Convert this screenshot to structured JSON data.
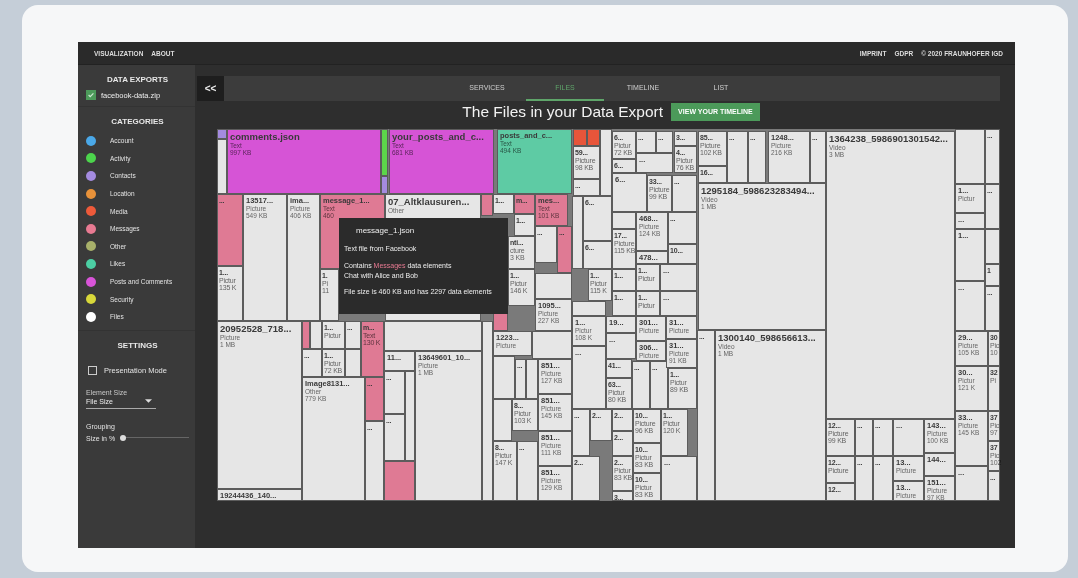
{
  "top_bar": {
    "left_links": [
      "VISUALIZATION",
      "ABOUT"
    ],
    "right_links": [
      "IMPRINT",
      "GDPR",
      "© 2020 FRAUNHOFER IGD"
    ]
  },
  "sidebar": {
    "exports_title": "DATA EXPORTS",
    "exports": [
      {
        "label": "facebook-data.zip",
        "checked": true
      }
    ],
    "categories_title": "CATEGORIES",
    "categories": [
      {
        "label": "Account",
        "color": "#4aa8e8"
      },
      {
        "label": "Activity",
        "color": "#4cd44c"
      },
      {
        "label": "Contacts",
        "color": "#a48be0"
      },
      {
        "label": "Location",
        "color": "#e8923a"
      },
      {
        "label": "Media",
        "color": "#ee5a3a"
      },
      {
        "label": "Messages",
        "color": "#e87a92"
      },
      {
        "label": "Other",
        "color": "#a8b06a"
      },
      {
        "label": "Likes",
        "color": "#4ccfa4"
      },
      {
        "label": "Posts and Comments",
        "color": "#d854d8"
      },
      {
        "label": "Security",
        "color": "#d8d83a"
      },
      {
        "label": "Files",
        "color": "#ffffff"
      }
    ],
    "settings_title": "SETTINGS",
    "presentation_mode": {
      "label": "Presentation Mode",
      "checked": false
    },
    "element_size": {
      "label": "Element Size",
      "value": "File Size"
    },
    "grouping": {
      "label": "Grouping Size in %",
      "level": 0
    }
  },
  "collapse_button": "<<",
  "tabs": [
    {
      "label": "SERVICES",
      "selected": false
    },
    {
      "label": "FILES",
      "selected": true
    },
    {
      "label": "TIMELINE",
      "selected": false
    },
    {
      "label": "LIST",
      "selected": false
    }
  ],
  "heading": "The Files in your Data Export",
  "timeline_button": "VIEW YOUR TIMELINE",
  "tiles": [
    {
      "color": "#a48be0"
    },
    {
      "label": "comments.json",
      "type": "Text",
      "size": "997 KB",
      "color": "#d654d6"
    },
    {
      "color": "#5cd64a"
    },
    {
      "label": "your_posts_and_c...",
      "type": "Text",
      "size": "681 KB",
      "color": "#d654d6"
    },
    {
      "label": "posts_and_c...",
      "type": "Text",
      "size": "494 KB",
      "color": "#5ecba4"
    },
    {
      "color": "#e8553a"
    },
    {
      "color": "#e8553a"
    },
    {
      "color": "#e6e6e6"
    },
    {
      "label": "6...",
      "type": "Pictur",
      "size": "72 KB",
      "color": "#e6e6e6"
    },
    {
      "label": "...",
      "color": "#e6e6e6"
    },
    {
      "label": "...",
      "color": "#e6e6e6"
    },
    {
      "label": "3...",
      "color": "#e6e6e6"
    },
    {
      "label": "85...",
      "type": "Picture",
      "size": "102 KB",
      "color": "#e6e6e6"
    },
    {
      "label": "...",
      "color": "#e6e6e6"
    },
    {
      "label": "...",
      "color": "#e6e6e6"
    },
    {
      "label": "1248...",
      "type": "Picture",
      "size": "216 KB",
      "color": "#e6e6e6"
    },
    {
      "label": "...",
      "color": "#e6e6e6"
    },
    {
      "label": "1364238_5986901301542...",
      "type": "Video",
      "size": "3 MB",
      "color": "#e6e6e6"
    },
    {
      "color": "#e6e6e6"
    },
    {
      "label": "...",
      "color": "#e6e6e6"
    },
    {
      "color": "#e6e6e6"
    },
    {
      "label": "59...",
      "type": "Picture",
      "size": "98 KB",
      "color": "#e6e6e6"
    },
    {
      "label": "6...",
      "color": "#e6e6e6"
    },
    {
      "label": "...",
      "color": "#e6e6e6"
    },
    {
      "label": "4...",
      "type": "Pictur",
      "size": "76 KB",
      "color": "#e6e6e6"
    },
    {
      "label": "16...",
      "color": "#e6e6e6"
    },
    {
      "color": "#a48be0"
    },
    {
      "label": "...",
      "color": "#e6e6e6"
    },
    {
      "label": "6...",
      "color": "#e6e6e6"
    },
    {
      "label": "33...",
      "type": "Picture",
      "size": "99 KB",
      "color": "#e6e6e6"
    },
    {
      "label": "...",
      "color": "#e6e6e6"
    },
    {
      "label": "1295184_598623283494...",
      "type": "Video",
      "size": "1 MB",
      "color": "#e6e6e6"
    },
    {
      "label": "1...",
      "type": "Pictur",
      "color": "#e6e6e6"
    },
    {
      "label": "...",
      "color": "#e6e6e6"
    },
    {
      "label": "...",
      "color": "#df7a94"
    },
    {
      "label": "13517...",
      "type": "Picture",
      "size": "549 KB",
      "color": "#e6e6e6"
    },
    {
      "label": "ima...",
      "type": "Picture",
      "size": "406 KB",
      "color": "#e6e6e6"
    },
    {
      "label": "message_1...",
      "type": "Text",
      "size": "460",
      "color": "#df7a94"
    },
    {
      "label": "07_Altklausuren...",
      "type": "Other",
      "color": "#e6e6e6"
    },
    {
      "color": "#df7a94"
    },
    {
      "label": "1...",
      "color": "#e6e6e6"
    },
    {
      "label": "m...",
      "color": "#df7a94"
    },
    {
      "label": "mes...",
      "type": "Text",
      "size": "101 KB",
      "color": "#df7a94"
    },
    {
      "color": "#e6e6e6"
    },
    {
      "label": "6...",
      "color": "#e6e6e6"
    },
    {
      "label": "1...",
      "color": "#e6e6e6"
    },
    {
      "color": "#e6e6e6"
    },
    {
      "label": "468...",
      "type": "Picture",
      "size": "124 KB",
      "color": "#e6e6e6"
    },
    {
      "label": "...",
      "color": "#e6e6e6"
    },
    {
      "label": "...",
      "color": "#e6e6e6"
    },
    {
      "label": "...",
      "color": "#e6e6e6"
    },
    {
      "label": "...",
      "color": "#df7a94"
    },
    {
      "label": "17...",
      "type": "Picture",
      "size": "115 KB",
      "color": "#e6e6e6"
    },
    {
      "label": "1...",
      "color": "#e6e6e6"
    },
    {
      "color": "#e6e6e6"
    },
    {
      "label": "nti...",
      "type": "cture",
      "size": "3 KB",
      "color": "#e6e6e6"
    },
    {
      "label": "6...",
      "color": "#e6e6e6"
    },
    {
      "label": "478...",
      "color": "#e6e6e6"
    },
    {
      "label": "10...",
      "color": "#e6e6e6"
    },
    {
      "label": "1...",
      "type": "Pictur",
      "size": "135 K",
      "color": "#e6e6e6"
    },
    {
      "label": "1.",
      "type": "Pi",
      "size": "11",
      "color": "#e6e6e6"
    },
    {
      "label": "1...",
      "type": "Pictur",
      "size": "146 K",
      "color": "#e6e6e6"
    },
    {
      "color": "#e6e6e6"
    },
    {
      "label": "1...",
      "type": "Pictur",
      "size": "115 K",
      "color": "#e6e6e6"
    },
    {
      "label": "1...",
      "color": "#e6e6e6"
    },
    {
      "label": "1...",
      "type": "Pictur",
      "color": "#e6e6e6"
    },
    {
      "label": "...",
      "color": "#e6e6e6"
    },
    {
      "label": "1",
      "color": "#e6e6e6"
    },
    {
      "label": "...",
      "color": "#e6e6e6"
    },
    {
      "label": "...",
      "color": "#e6e6e6"
    },
    {
      "label": "1...",
      "color": "#e6e6e6"
    },
    {
      "label": "1...",
      "type": "Pictur",
      "color": "#e6e6e6"
    },
    {
      "label": "...",
      "color": "#e6e6e6"
    },
    {
      "color": "#df7a94"
    },
    {
      "label": "1095...",
      "type": "Picture",
      "size": "227 KB",
      "color": "#e6e6e6"
    },
    {
      "color": "#e6e6e6"
    },
    {
      "label": "1...",
      "type": "Pictur",
      "size": "108 K",
      "color": "#e6e6e6"
    },
    {
      "label": "19...",
      "color": "#e6e6e6"
    },
    {
      "label": "301...",
      "type": "Picture",
      "color": "#e6e6e6"
    },
    {
      "label": "31...",
      "type": "Picture",
      "color": "#e6e6e6"
    },
    {
      "label": "20952528_718...",
      "type": "Picture",
      "size": "1 MB",
      "color": "#e6e6e6"
    },
    {
      "label": "19244436_140...",
      "color": "#e6e6e6"
    },
    {
      "color": "#df7a94"
    },
    {
      "color": "#e6e6e6"
    },
    {
      "label": "1...",
      "type": "Pictur",
      "color": "#e6e6e6"
    },
    {
      "label": "...",
      "color": "#e6e6e6"
    },
    {
      "label": "m...",
      "type": "Text",
      "size": "130 K",
      "color": "#df7a94"
    },
    {
      "color": "#e6e6e6"
    },
    {
      "color": "#e6e6e6"
    },
    {
      "label": "1223...",
      "type": "Picture",
      "color": "#e6e6e6"
    },
    {
      "color": "#e6e6e6"
    },
    {
      "label": "...",
      "color": "#e6e6e6"
    },
    {
      "label": "...",
      "color": "#e6e6e6"
    },
    {
      "label": "1300140_598656613...",
      "type": "Video",
      "size": "1 MB",
      "color": "#e6e6e6"
    },
    {
      "label": "29...",
      "type": "Picture",
      "size": "105 KB",
      "color": "#e6e6e6"
    },
    {
      "label": "30",
      "type": "Pic",
      "size": "10",
      "color": "#e6e6e6"
    },
    {
      "label": "...",
      "color": "#e6e6e6"
    },
    {
      "label": "1...",
      "type": "Pictur",
      "size": "72 KB",
      "color": "#e6e6e6"
    },
    {
      "color": "#e6e6e6"
    },
    {
      "label": "11...",
      "color": "#e6e6e6"
    },
    {
      "label": "13649601_10...",
      "type": "Picture",
      "size": "1 MB",
      "color": "#e6e6e6"
    },
    {
      "color": "#e6e6e6"
    },
    {
      "label": "...",
      "color": "#e6e6e6"
    },
    {
      "color": "#e6e6e6"
    },
    {
      "label": "851...",
      "type": "Picture",
      "size": "127 KB",
      "color": "#e6e6e6"
    },
    {
      "label": "...",
      "color": "#e6e6e6"
    },
    {
      "label": "41...",
      "color": "#e6e6e6"
    },
    {
      "label": "...",
      "color": "#e6e6e6"
    },
    {
      "label": "306...",
      "type": "Picture",
      "color": "#e6e6e6"
    },
    {
      "label": "...",
      "color": "#e6e6e6"
    },
    {
      "label": "31...",
      "type": "Picture",
      "size": "91 KB",
      "color": "#e6e6e6"
    },
    {
      "label": "Image8131...",
      "type": "Other",
      "size": "779 KB",
      "color": "#e6e6e6"
    },
    {
      "label": "...",
      "color": "#df7a94"
    },
    {
      "label": "...",
      "color": "#e6e6e6"
    },
    {
      "color": "#e6e6e6"
    },
    {
      "label": "63...",
      "type": "Pictur",
      "size": "80 KB",
      "color": "#e6e6e6"
    },
    {
      "label": "1...",
      "type": "Pictur",
      "size": "89 KB",
      "color": "#e6e6e6"
    },
    {
      "label": "30...",
      "type": "Pictur",
      "size": "121 K",
      "color": "#e6e6e6"
    },
    {
      "label": "32",
      "type": "Pi",
      "color": "#e6e6e6"
    },
    {
      "color": "#e6e6e6"
    },
    {
      "label": "8...",
      "type": "Pictur",
      "size": "103 K",
      "color": "#e6e6e6"
    },
    {
      "label": "851...",
      "type": "Picture",
      "size": "145 KB",
      "color": "#e6e6e6"
    },
    {
      "label": "...",
      "color": "#e6e6e6"
    },
    {
      "label": "...",
      "color": "#e6e6e6"
    },
    {
      "label": "2...",
      "color": "#e6e6e6"
    },
    {
      "label": "2...",
      "color": "#e6e6e6"
    },
    {
      "label": "10...",
      "type": "Picture",
      "size": "96 KB",
      "color": "#e6e6e6"
    },
    {
      "label": "1...",
      "type": "Pictur",
      "size": "120 K",
      "color": "#e6e6e6"
    },
    {
      "label": "33...",
      "type": "Picture",
      "size": "145 KB",
      "color": "#e6e6e6"
    },
    {
      "label": "37",
      "type": "Pic",
      "size": "97",
      "color": "#e6e6e6"
    },
    {
      "label": "...",
      "color": "#e6e6e6"
    },
    {
      "label": "12...",
      "type": "Picture",
      "size": "99 KB",
      "color": "#e6e6e6"
    },
    {
      "label": "...",
      "color": "#e6e6e6"
    },
    {
      "label": "...",
      "color": "#e6e6e6"
    },
    {
      "label": "...",
      "color": "#e6e6e6"
    },
    {
      "label": "143...",
      "type": "Picture",
      "size": "100 KB",
      "color": "#e6e6e6"
    },
    {
      "label": "851...",
      "type": "Picture",
      "size": "111 KB",
      "color": "#e6e6e6"
    },
    {
      "label": "2...",
      "color": "#e6e6e6"
    },
    {
      "label": "8...",
      "type": "Pictur",
      "size": "147 K",
      "color": "#e6e6e6"
    },
    {
      "label": "...",
      "color": "#e6e6e6"
    },
    {
      "label": "2...",
      "color": "#e6e6e6"
    },
    {
      "label": "2...",
      "type": "Pictur",
      "size": "83 KB",
      "color": "#e6e6e6"
    },
    {
      "label": "3...",
      "color": "#e6e6e6"
    },
    {
      "label": "10...",
      "type": "Pictur",
      "size": "83 KB",
      "color": "#e6e6e6"
    },
    {
      "label": "...",
      "color": "#e6e6e6"
    },
    {
      "label": "12...",
      "type": "Picture",
      "color": "#e6e6e6"
    },
    {
      "label": "...",
      "color": "#e6e6e6"
    },
    {
      "label": "...",
      "color": "#e6e6e6"
    },
    {
      "label": "13...",
      "type": "Picture",
      "color": "#e6e6e6"
    },
    {
      "label": "144...",
      "color": "#e6e6e6"
    },
    {
      "label": "37",
      "type": "Pic",
      "size": "102",
      "color": "#e6e6e6"
    },
    {
      "color": "#df7a94"
    },
    {
      "label": "851...",
      "type": "Picture",
      "size": "129 KB",
      "color": "#e6e6e6"
    },
    {
      "label": "...",
      "color": "#e6e6e6"
    },
    {
      "label": "10...",
      "type": "Pictur",
      "size": "83 KB",
      "color": "#e6e6e6"
    },
    {
      "label": "151...",
      "type": "Picture",
      "size": "97 KB",
      "color": "#e6e6e6"
    },
    {
      "label": "...",
      "color": "#e6e6e6"
    },
    {
      "label": "12...",
      "color": "#e6e6e6"
    },
    {
      "label": "13...",
      "type": "Picture",
      "color": "#e6e6e6"
    }
  ],
  "tooltip": {
    "title": "message_1.json",
    "source": "Text file from Facebook",
    "contains": [
      "Contains",
      "Messages",
      "data elements"
    ],
    "detail": "Chat with Alice and Bob",
    "stats": "File size is 460 KB and has 2297 data elements"
  }
}
